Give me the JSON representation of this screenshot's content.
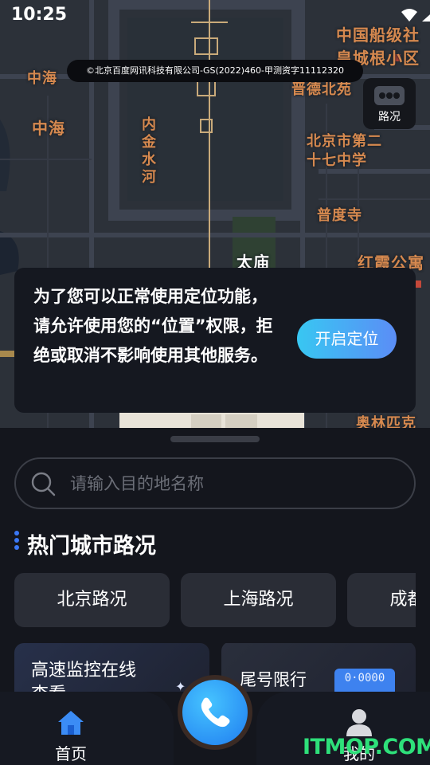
{
  "status_bar": {
    "time": "10:25"
  },
  "map": {
    "copyright": "©北京百度网讯科技有限公司-GS(2022)460-甲测资字11112320",
    "labels": {
      "l1": "中国船级社",
      "l2": "皇城根小区",
      "l3": "中海",
      "l4": "晋德北苑",
      "l5": "中海",
      "l6": "内金水河",
      "l7": "北京市第二",
      "l8": "十七中学",
      "l9": "普度寺",
      "l10": "太庙",
      "l11": "红霞公寓",
      "l12": "奥林匹克"
    },
    "traffic_button_label": "路况"
  },
  "permission_dialog": {
    "message": "为了您可以正常使用定位功能，请允许使用您的“位置”权限，拒绝或取消不影响使用其他服务。",
    "enable_button": "开启定位"
  },
  "search": {
    "placeholder": "请输入目的地名称"
  },
  "hot_cities": {
    "title": "热门城市路况",
    "cities": [
      "北京路况",
      "上海路况",
      "成都路况"
    ]
  },
  "feature_cards": {
    "highway": "高速监控在线查看",
    "plate_limit": "尾号限行",
    "plate_text": "0·0000"
  },
  "tabbar": {
    "home": "首页",
    "me": "我的"
  },
  "watermark": "ITMOP.COM",
  "colors": {
    "accent": "#3b78f5",
    "map_label": "#d6894f",
    "watermark": "#2ee07a"
  }
}
